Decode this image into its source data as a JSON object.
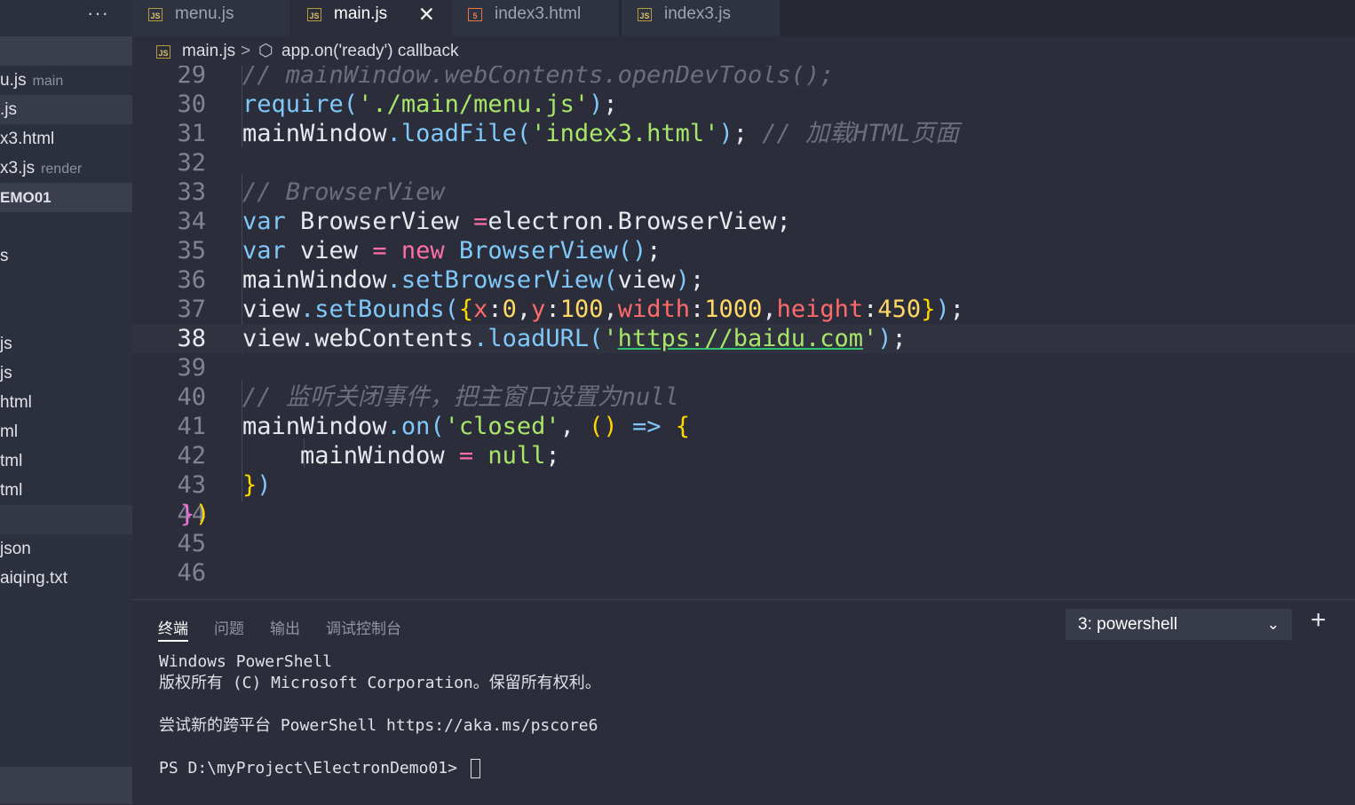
{
  "sidebar": {
    "more_label": "···",
    "items": [
      {
        "label": "",
        "desc": ""
      },
      {
        "label": "u.js",
        "desc": "main"
      },
      {
        "label": ".js",
        "desc": ""
      },
      {
        "label": "x3.html",
        "desc": ""
      },
      {
        "label": "x3.js",
        "desc": "render"
      },
      {
        "label": "EMO01",
        "desc": ""
      },
      {
        "label": "",
        "desc": ""
      },
      {
        "label": "s",
        "desc": ""
      },
      {
        "label": "",
        "desc": ""
      },
      {
        "label": "js",
        "desc": ""
      },
      {
        "label": "js",
        "desc": ""
      },
      {
        "label": "html",
        "desc": ""
      },
      {
        "label": "ml",
        "desc": ""
      },
      {
        "label": "tml",
        "desc": ""
      },
      {
        "label": "tml",
        "desc": ""
      },
      {
        "label": "",
        "desc": ""
      },
      {
        "label": "json",
        "desc": ""
      },
      {
        "label": "aiqing.txt",
        "desc": ""
      }
    ]
  },
  "tabs": [
    {
      "label": "menu.js",
      "icon": "JS"
    },
    {
      "label": "main.js",
      "icon": "JS",
      "close": "✕"
    },
    {
      "label": "index3.html",
      "icon": "5"
    },
    {
      "label": "index3.js",
      "icon": "JS"
    }
  ],
  "breadcrumb": {
    "icon": "JS",
    "file": "main.js",
    "separator": ">",
    "symbol_icon": "⬡",
    "symbol": "app.on('ready') callback"
  },
  "editor": {
    "line_numbers": [
      "29",
      "30",
      "31",
      "32",
      "33",
      "34",
      "35",
      "36",
      "37",
      "38",
      "39",
      "40",
      "41",
      "42",
      "43",
      "44",
      "45",
      "46"
    ],
    "current_line": "38"
  },
  "panel": {
    "tabs": [
      "终端",
      "问题",
      "输出",
      "调试控制台"
    ],
    "terminal_select": "3: powershell",
    "chevron": "⌄",
    "add": "+",
    "terminal_lines": [
      "Windows PowerShell",
      "版权所有 (C) Microsoft Corporation。保留所有权利。",
      "",
      "尝试新的跨平台 PowerShell https://aka.ms/pscore6",
      "",
      "PS D:\\myProject\\ElectronDemo01> "
    ]
  },
  "colors": {
    "background": "#2b2d3a",
    "keyword": "#7fc8f9",
    "string": "#a8e56a",
    "comment": "#6a6e7e",
    "operator": "#ff6ea5"
  }
}
